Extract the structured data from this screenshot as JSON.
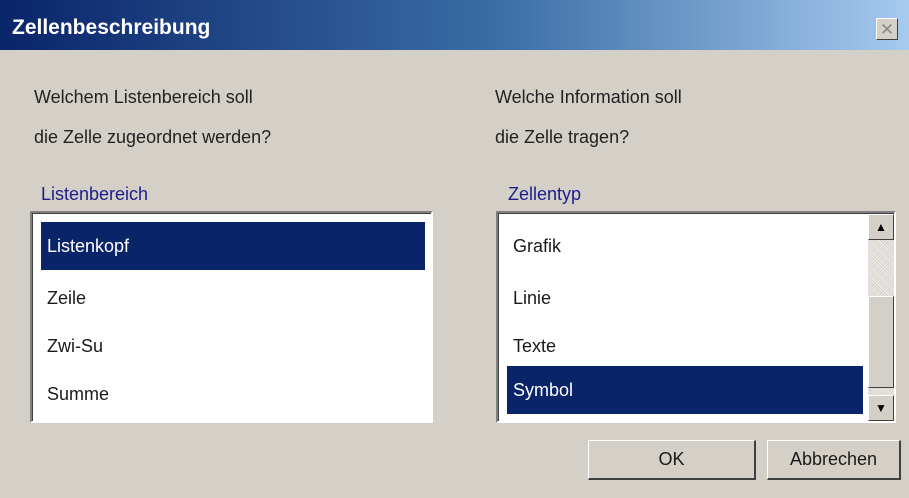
{
  "window": {
    "title": "Zellenbeschreibung",
    "close_glyph": "✕"
  },
  "left": {
    "question_line1": "Welchem Listenbereich soll",
    "question_line2": "die Zelle zugeordnet werden?",
    "group_label": "Listenbereich",
    "items": [
      "Listenkopf",
      "Zeile",
      "Zwi-Su",
      "Summe"
    ],
    "selected": "Listenkopf"
  },
  "right": {
    "question_line1": "Welche Information soll",
    "question_line2": "die Zelle tragen?",
    "group_label": "Zellentyp",
    "items": [
      "Grafik",
      "Linie",
      "Texte",
      "Symbol"
    ],
    "selected": "Symbol",
    "scroll_up_glyph": "▲",
    "scroll_down_glyph": "▼"
  },
  "buttons": {
    "ok": "OK",
    "cancel": "Abbrechen"
  },
  "colors": {
    "selection": "#0a246a",
    "titlebar_start": "#0a246a",
    "titlebar_end": "#a6caf0",
    "group_label": "#1c1c8c"
  }
}
